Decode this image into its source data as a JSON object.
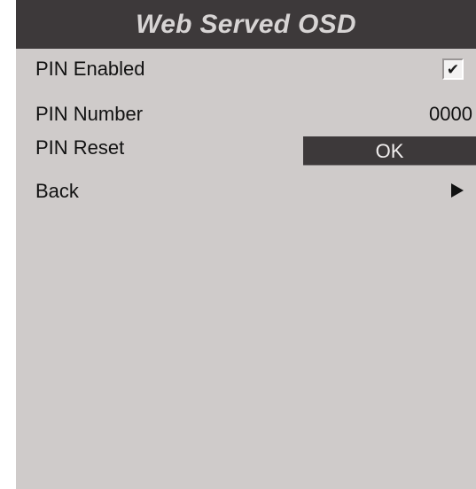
{
  "osd": {
    "title": "Web Served OSD",
    "items": [
      {
        "label": "PIN Enabled",
        "control": "checkbox",
        "checked": true,
        "check_glyph": "✔"
      },
      {
        "label": "PIN Number",
        "value": "0000"
      },
      {
        "label": "PIN Reset",
        "button_label": "OK"
      },
      {
        "label": "Back",
        "icon": "play-arrow-icon"
      }
    ]
  },
  "colors": {
    "panel_background": "#cfcbca",
    "title_bar": "#3d393a",
    "title_text": "#d7d4d4",
    "button_background": "#3d393a",
    "button_text": "#f1eeee"
  }
}
